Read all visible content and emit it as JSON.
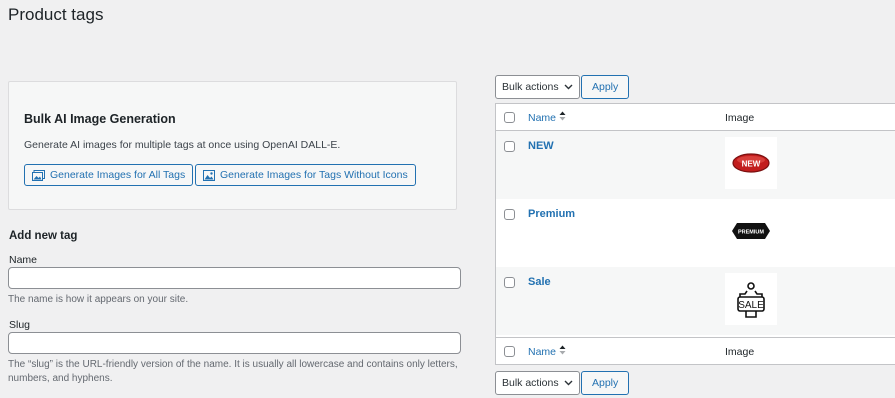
{
  "page": {
    "title": "Product tags"
  },
  "ai_box": {
    "title": "Bulk AI Image Generation",
    "description": "Generate AI images for multiple tags at once using OpenAI DALL-E.",
    "btn_all": "Generate Images for All Tags",
    "btn_without": "Generate Images for Tags Without Icons"
  },
  "form": {
    "heading": "Add new tag",
    "name_label": "Name",
    "name_value": "",
    "name_help": "The name is how it appears on your site.",
    "slug_label": "Slug",
    "slug_value": "",
    "slug_help_1": "The “slug” is the URL-friendly version of the name. It is usually all lowercase and contains only letters,",
    "slug_help_2": "numbers, and hyphens."
  },
  "table": {
    "bulk_actions": "Bulk actions",
    "apply": "Apply",
    "col_name": "Name",
    "col_image": "Image",
    "rows": [
      {
        "name": "NEW",
        "image_text": "NEW",
        "image_icon": "red-badge-icon"
      },
      {
        "name": "Premium",
        "image_text": "PREMIUM",
        "image_icon": "black-badge-icon"
      },
      {
        "name": "Sale",
        "image_text": "SALE",
        "image_icon": "sale-tag-icon"
      }
    ]
  },
  "colors": {
    "accent": "#2271b1",
    "background": "#f0f0f1"
  }
}
